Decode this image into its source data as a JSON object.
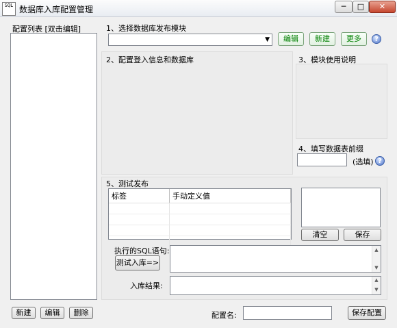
{
  "window": {
    "title": "数据库入库配置管理",
    "icon_text": "SQL",
    "minimize_label": "─",
    "maximize_label": "□",
    "close_label": "✕"
  },
  "config_list": {
    "header": "配置列表 [双击编辑]",
    "items": []
  },
  "section1": {
    "title": "1、选择数据库发布模块",
    "selected_value": "",
    "dropdown_arrow": "▼",
    "edit_label": "编辑",
    "new_label": "新建",
    "more_label": "更多",
    "help_label": "?"
  },
  "section2": {
    "title": "2、配置登入信息和数据库"
  },
  "section3": {
    "title": "3、模块使用说明"
  },
  "section4": {
    "title": "4、填写数据表前缀",
    "input_value": "",
    "optional_label": "(选填)",
    "help_label": "?"
  },
  "section5": {
    "title": "5、测试发布",
    "columns": [
      "标签",
      "手动定义值"
    ],
    "rows": [
      [
        "",
        ""
      ],
      [
        "",
        ""
      ],
      [
        "",
        ""
      ],
      [
        "",
        ""
      ]
    ],
    "clear_label": "清空",
    "save_label": "保存",
    "sql_label": "执行的SQL语句:",
    "test_button_label": "测试入库=>",
    "result_label": "入库结果:",
    "sql_value": "",
    "result_value": ""
  },
  "bottom": {
    "new_label": "新建",
    "edit_label": "编辑",
    "delete_label": "删除",
    "config_name_label": "配置名:",
    "config_name_value": "",
    "save_config_label": "保存配置"
  },
  "colors": {
    "accent_green": "#008000",
    "window_bg": "#f0f0f0",
    "help_blue": "#4f75c9"
  }
}
